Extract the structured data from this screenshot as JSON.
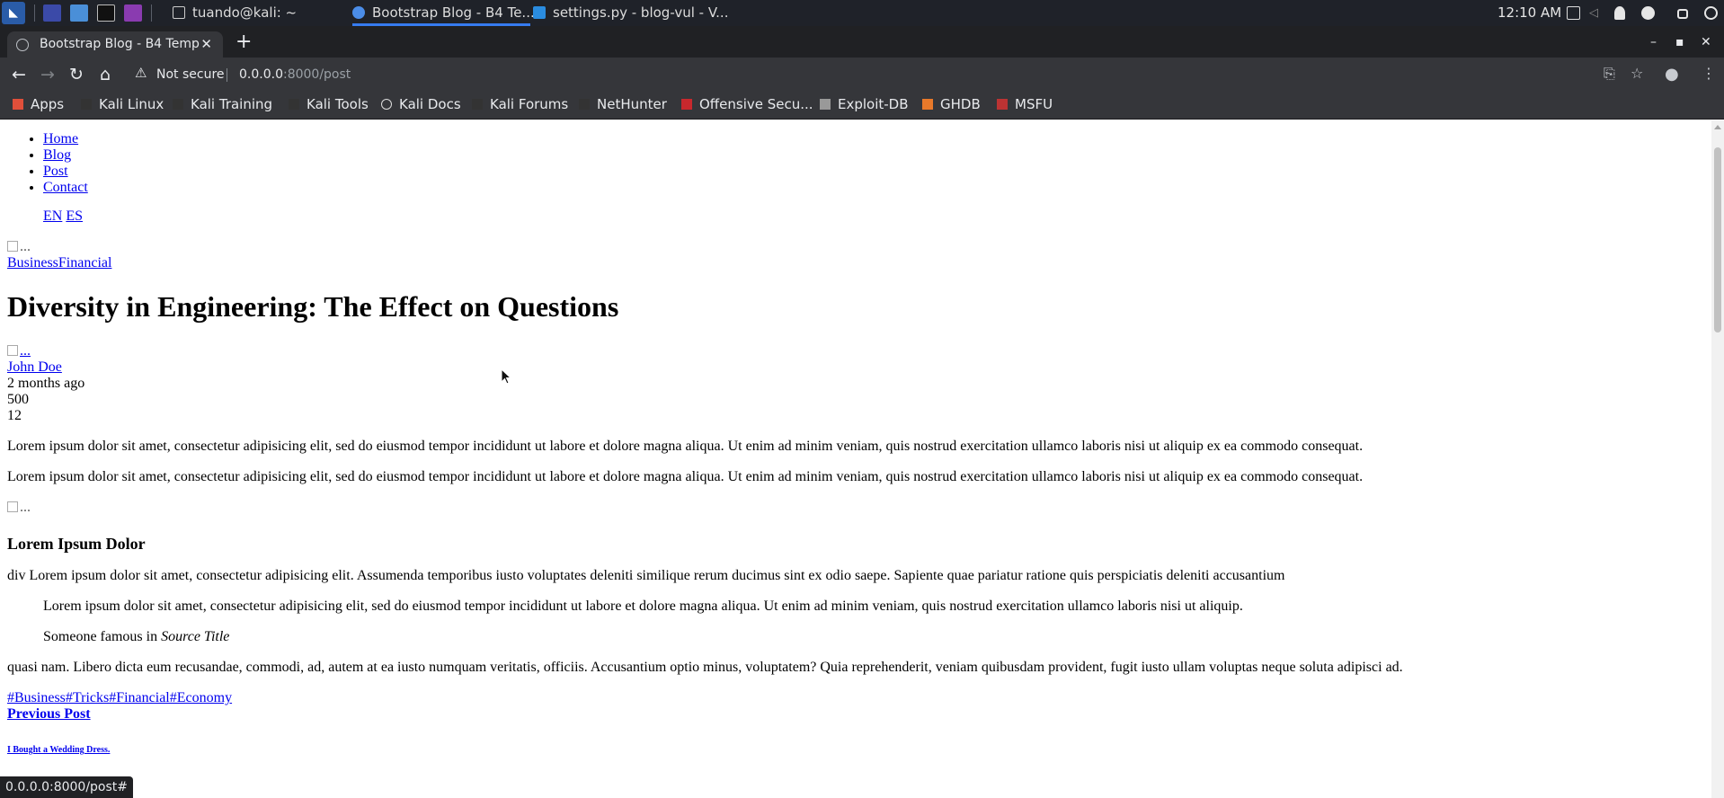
{
  "os_panel": {
    "tasks": [
      {
        "label": "tuando@kali: ~",
        "icon": "terminal-icon"
      },
      {
        "label": "Bootstrap Blog - B4 Te...",
        "icon": "chrome-icon"
      },
      {
        "label": "settings.py - blog-vul - V...",
        "icon": "vscode-icon"
      }
    ],
    "clock": "12:10 AM"
  },
  "browser": {
    "tab_title": "Bootstrap Blog - B4 Temp",
    "security": "Not secure",
    "url_host": "0.0.0.0",
    "url_rest": ":8000/post",
    "bookmarks": [
      "Apps",
      "Kali Linux",
      "Kali Training",
      "Kali Tools",
      "Kali Docs",
      "Kali Forums",
      "NetHunter",
      "Offensive Secu...",
      "Exploit-DB",
      "GHDB",
      "MSFU"
    ],
    "status_url": "0.0.0.0:8000/post#"
  },
  "page": {
    "nav": [
      "Home",
      "Blog",
      "Post",
      "Contact"
    ],
    "lang": [
      "EN",
      "ES"
    ],
    "img_alt": "...",
    "categories": "BusinessFinancial",
    "title": "Diversity in Engineering: The Effect on Questions",
    "author": "John Doe",
    "date": "2 months ago",
    "views": "500",
    "comments": "12",
    "para1": "Lorem ipsum dolor sit amet, consectetur adipisicing elit, sed do eiusmod tempor incididunt ut labore et dolore magna aliqua. Ut enim ad minim veniam, quis nostrud exercitation ullamco laboris nisi ut aliquip ex ea commodo consequat.",
    "para2": "Lorem ipsum dolor sit amet, consectetur adipisicing elit, sed do eiusmod tempor incididunt ut labore et dolore magna aliqua. Ut enim ad minim veniam, quis nostrud exercitation ullamco laboris nisi ut aliquip ex ea commodo consequat.",
    "subheading": "Lorem Ipsum Dolor",
    "para3": "div Lorem ipsum dolor sit amet, consectetur adipisicing elit. Assumenda temporibus iusto voluptates deleniti similique rerum ducimus sint ex odio saepe. Sapiente quae pariatur ratione quis perspiciatis deleniti accusantium",
    "quote": "Lorem ipsum dolor sit amet, consectetur adipisicing elit, sed do eiusmod tempor incididunt ut labore et dolore magna aliqua. Ut enim ad minim veniam, quis nostrud exercitation ullamco laboris nisi ut aliquip.",
    "quote_source_prefix": "Someone famous in",
    "quote_source_title": "Source Title",
    "para4": "quasi nam. Libero dicta eum recusandae, commodi, ad, autem at ea iusto numquam veritatis, officiis. Accusantium optio minus, voluptatem? Quia reprehenderit, veniam quibusdam provident, fugit iusto ullam voluptas neque soluta adipisci ad.",
    "tags": "#Business#Tricks#Financial#Economy",
    "prev_label": "Previous Post",
    "prev_title": "I Bought a Wedding Dress."
  },
  "colors": {
    "link": "#0000ee",
    "panel": "#1f2229",
    "chrome_dark": "#35363a",
    "accent": "#367bf0"
  }
}
